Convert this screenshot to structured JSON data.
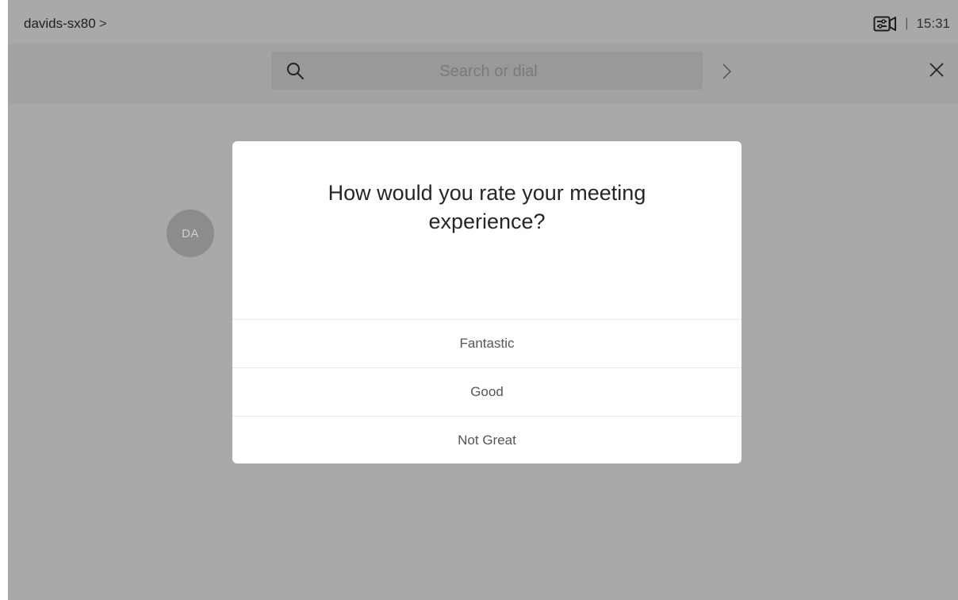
{
  "status_bar": {
    "device_name": "davids-sx80",
    "device_chevron": ">",
    "camera_icon": "camera-settings-icon",
    "separator": "|",
    "time": "15:31"
  },
  "search": {
    "placeholder": "Search or dial",
    "search_icon": "search-icon",
    "go_icon": "chevron-right-icon",
    "close_icon": "close-icon"
  },
  "contact": {
    "avatar_initials": "DA"
  },
  "dialog": {
    "title": "How would you rate your meeting experience?",
    "options": [
      {
        "label": "Fantastic"
      },
      {
        "label": "Good"
      },
      {
        "label": "Not Great"
      }
    ]
  },
  "colors": {
    "overlay_background": "#a9a9a9",
    "dialog_background": "#ffffff",
    "option_text": "#555555"
  }
}
